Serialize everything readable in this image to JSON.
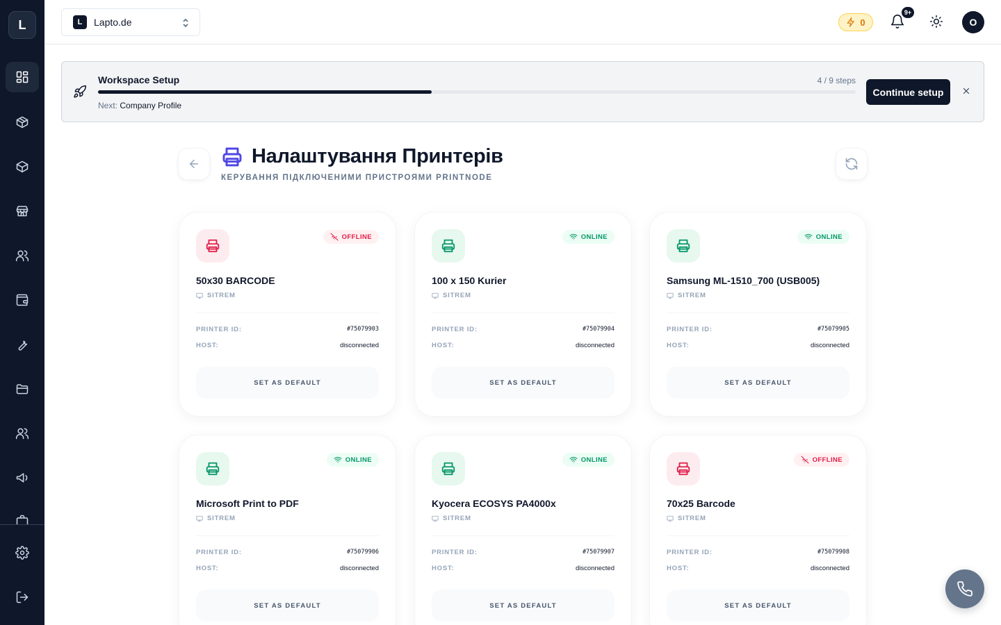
{
  "sidebar": {
    "logo": "L",
    "items": [
      {
        "icon": "dashboard-icon",
        "active": true
      },
      {
        "icon": "box-icon"
      },
      {
        "icon": "package-icon"
      },
      {
        "icon": "store-icon"
      },
      {
        "icon": "users-icon"
      },
      {
        "icon": "wallet-icon"
      },
      {
        "icon": "wrench-icon"
      },
      {
        "icon": "folder-icon"
      },
      {
        "icon": "team-icon"
      },
      {
        "icon": "megaphone-icon"
      }
    ],
    "bottom": [
      {
        "icon": "settings-icon"
      },
      {
        "icon": "logout-icon"
      }
    ]
  },
  "header": {
    "workspace_badge": "L",
    "workspace_name": "Lapto.de",
    "credits": "0",
    "notifications_badge": "9+",
    "avatar": "O"
  },
  "setup": {
    "title": "Workspace Setup",
    "steps": "4 / 9 steps",
    "progress": 0.44,
    "next_label": "Next:",
    "next_step": "Company Profile",
    "button": "Continue setup"
  },
  "page": {
    "title": "Налаштування Принтерів",
    "subtitle": "КЕРУВАННЯ ПІДКЛЮЧЕНИМИ ПРИСТРОЯМИ PRINTNODE"
  },
  "labels": {
    "printer_id": "PRINTER ID:",
    "host": "HOST:",
    "set_default": "SET AS DEFAULT"
  },
  "printers": [
    {
      "name": "50x30 BARCODE",
      "computer": "SITREM",
      "status": "OFFLINE",
      "online": false,
      "id": "#75079903",
      "host": "disconnected"
    },
    {
      "name": "100 x 150 Kurier",
      "computer": "SITREM",
      "status": "ONLINE",
      "online": true,
      "id": "#75079904",
      "host": "disconnected"
    },
    {
      "name": "Samsung ML-1510_700 (USB005)",
      "computer": "SITREM",
      "status": "ONLINE",
      "online": true,
      "id": "#75079905",
      "host": "disconnected"
    },
    {
      "name": "Microsoft Print to PDF",
      "computer": "SITREM",
      "status": "ONLINE",
      "online": true,
      "id": "#75079906",
      "host": "disconnected"
    },
    {
      "name": "Kyocera ECOSYS PA4000x",
      "computer": "SITREM",
      "status": "ONLINE",
      "online": true,
      "id": "#75079907",
      "host": "disconnected"
    },
    {
      "name": "70x25 Barcode",
      "computer": "SITREM",
      "status": "OFFLINE",
      "online": false,
      "id": "#75079908",
      "host": "disconnected"
    }
  ],
  "colors": {
    "sidebar_bg": "#0f172a",
    "accent": "#4f46e5",
    "online": "#059669",
    "offline": "#e11d48"
  }
}
